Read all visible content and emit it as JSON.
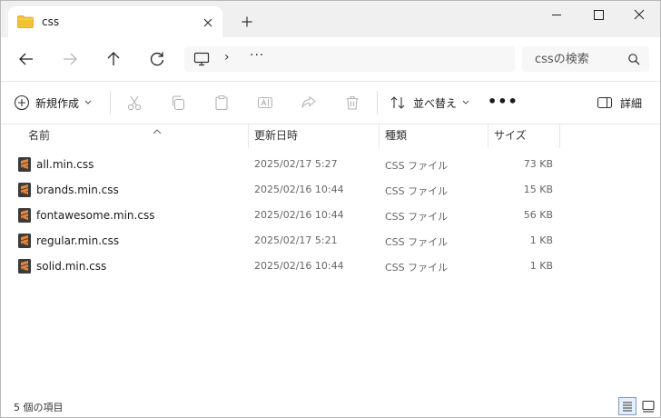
{
  "tab": {
    "title": "css"
  },
  "search": {
    "placeholder": "cssの検索"
  },
  "toolbar": {
    "new_label": "新規作成",
    "sort_label": "並べ替え",
    "details_label": "詳細",
    "more_label": "•••"
  },
  "address": {
    "more": "···",
    "chevron": "›"
  },
  "columns": {
    "name": "名前",
    "date": "更新日時",
    "type": "種類",
    "size": "サイズ"
  },
  "files": [
    {
      "name": "all.min.css",
      "date": "2025/02/17 5:27",
      "type": "CSS ファイル",
      "size": "73 KB"
    },
    {
      "name": "brands.min.css",
      "date": "2025/02/16 10:44",
      "type": "CSS ファイル",
      "size": "15 KB"
    },
    {
      "name": "fontawesome.min.css",
      "date": "2025/02/16 10:44",
      "type": "CSS ファイル",
      "size": "56 KB"
    },
    {
      "name": "regular.min.css",
      "date": "2025/02/17 5:21",
      "type": "CSS ファイル",
      "size": "1 KB"
    },
    {
      "name": "solid.min.css",
      "date": "2025/02/16 10:44",
      "type": "CSS ファイル",
      "size": "1 KB"
    }
  ],
  "status": {
    "item_count": "5 個の項目"
  },
  "icons": {
    "tab": "folder-icon",
    "file": "sublime-css-file-icon",
    "path": "computer-icon",
    "search": "search-icon"
  },
  "colors": {
    "folder": "#f2c232",
    "file_icon": "#e8863a",
    "accent": "#0067c0"
  }
}
